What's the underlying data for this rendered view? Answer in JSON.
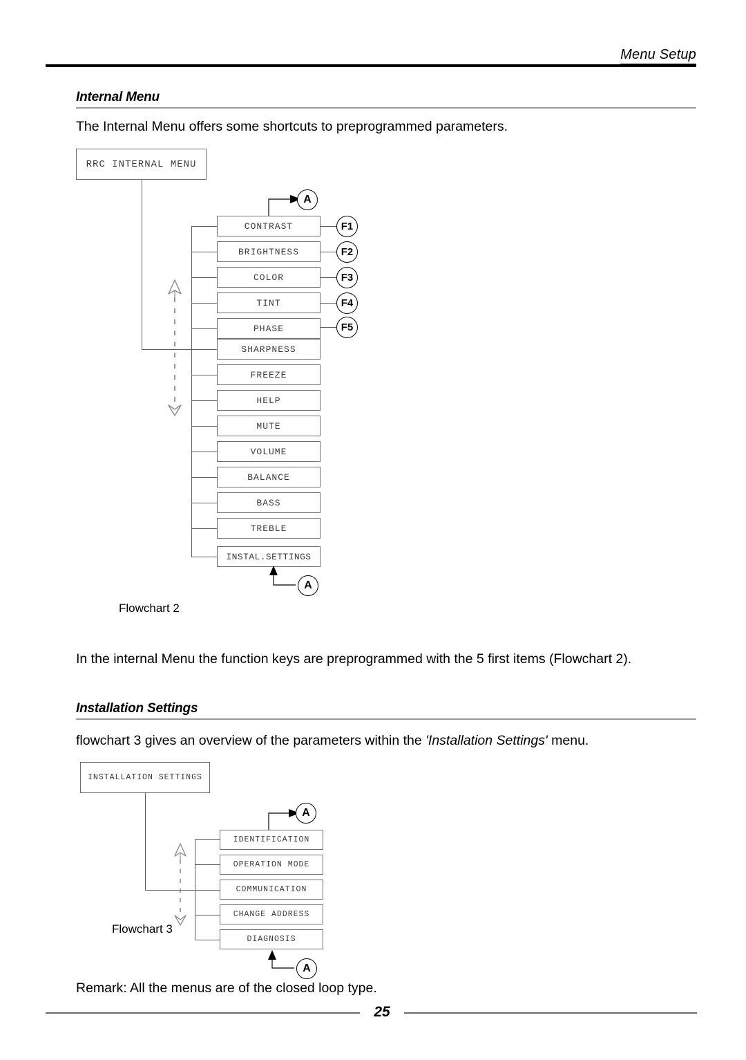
{
  "header": {
    "title": "Menu Setup"
  },
  "sections": [
    {
      "heading": "Internal Menu",
      "intro": "The Internal Menu offers some shortcuts to preprogrammed parameters.",
      "outro": "In the internal Menu the function keys are preprogrammed with the 5 first items (Flowchart 2)."
    },
    {
      "heading": "Installation Settings",
      "intro_before": "flowchart 3 gives an overview of the parameters within the ",
      "intro_emphasis": "'Installation Settings'",
      "intro_after": " menu.",
      "remark": "Remark: All the menus are of the closed loop type."
    }
  ],
  "flowchart2": {
    "caption": "Flowchart 2",
    "root_label": "RRC INTERNAL MENU",
    "connector_top_label": "A",
    "connector_bottom_label": "A",
    "items": [
      {
        "label": "CONTRAST",
        "fkey": "F1"
      },
      {
        "label": "BRIGHTNESS",
        "fkey": "F2"
      },
      {
        "label": "COLOR",
        "fkey": "F3"
      },
      {
        "label": "TINT",
        "fkey": "F4"
      },
      {
        "label": "PHASE",
        "fkey": "F5"
      },
      {
        "label": "SHARPNESS",
        "fkey": ""
      },
      {
        "label": "FREEZE",
        "fkey": ""
      },
      {
        "label": "HELP",
        "fkey": ""
      },
      {
        "label": "MUTE",
        "fkey": ""
      },
      {
        "label": "VOLUME",
        "fkey": ""
      },
      {
        "label": "BALANCE",
        "fkey": ""
      },
      {
        "label": "BASS",
        "fkey": ""
      },
      {
        "label": "TREBLE",
        "fkey": ""
      },
      {
        "label": "INSTAL.SETTINGS",
        "fkey": ""
      }
    ]
  },
  "flowchart3": {
    "caption": "Flowchart 3",
    "root_label": "INSTALLATION SETTINGS",
    "connector_top_label": "A",
    "connector_bottom_label": "A",
    "items": [
      {
        "label": "IDENTIFICATION"
      },
      {
        "label": "OPERATION MODE"
      },
      {
        "label": "COMMUNICATION"
      },
      {
        "label": "CHANGE ADDRESS"
      },
      {
        "label": "DIAGNOSIS"
      }
    ]
  },
  "footer": {
    "page_number": "25"
  },
  "colors": {
    "rule_dark": "#000000",
    "rule_light": "#9a9a9a",
    "box_border": "#6e6e6e",
    "box_text": "#3a3a3a",
    "line": "#5e5e5e"
  }
}
